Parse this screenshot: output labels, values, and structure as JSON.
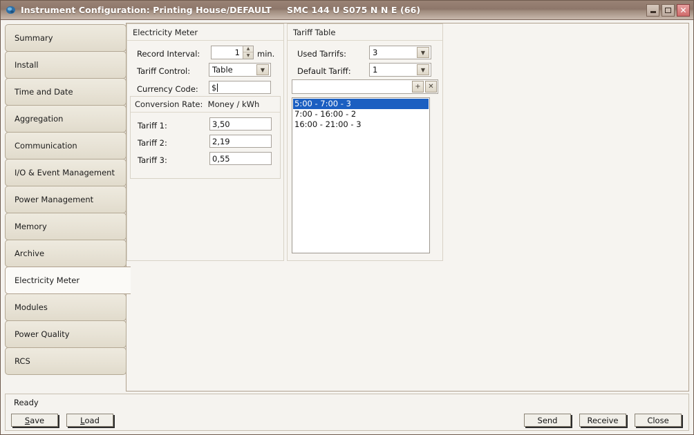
{
  "window": {
    "title": "Instrument Configuration: Printing House/DEFAULT     SMC 144 U S075 N N E (66)",
    "icon": "app-globe-icon",
    "controls": {
      "minimize": "minimize-icon",
      "maximize": "maximize-icon",
      "close": "✕"
    }
  },
  "sidebar": {
    "items": [
      {
        "label": "Summary",
        "selected": false
      },
      {
        "label": "Install",
        "selected": false
      },
      {
        "label": "Time and Date",
        "selected": false
      },
      {
        "label": "Aggregation",
        "selected": false
      },
      {
        "label": "Communication",
        "selected": false
      },
      {
        "label": "I/O & Event Management",
        "selected": false
      },
      {
        "label": "Power Management",
        "selected": false
      },
      {
        "label": "Memory",
        "selected": false
      },
      {
        "label": "Archive",
        "selected": false
      },
      {
        "label": "Electricity Meter",
        "selected": true
      },
      {
        "label": "Modules",
        "selected": false
      },
      {
        "label": "Power Quality",
        "selected": false
      },
      {
        "label": "RCS",
        "selected": false
      }
    ]
  },
  "electricity_meter": {
    "panel_title": "Electricity Meter",
    "record_interval": {
      "label": "Record Interval:",
      "value": "1",
      "unit": "min.",
      "spin_up": "▲",
      "spin_down": "▼"
    },
    "tariff_control": {
      "label": "Tariff Control:",
      "value": "Table",
      "arrow": "▼"
    },
    "currency_code": {
      "label": "Currency Code:",
      "value": "$"
    },
    "conversion_rate": {
      "title": "Conversion Rate:  Money / kWh",
      "rows": [
        {
          "label": "Tariff 1:",
          "value": "3,50"
        },
        {
          "label": "Tariff 2:",
          "value": "2,19"
        },
        {
          "label": "Tariff 3:",
          "value": "0,55"
        }
      ]
    }
  },
  "tariff_table": {
    "panel_title": "Tariff Table",
    "used_tariffs": {
      "label": "Used Tarrifs:",
      "value": "3",
      "arrow": "▼"
    },
    "default_tariff": {
      "label": "Default Tariff:",
      "value": "1",
      "arrow": "▼"
    },
    "entry_field": {
      "value": "",
      "placeholder": ""
    },
    "add_button": "+",
    "delete_button": "✕",
    "entries": [
      {
        "text": "5:00 - 7:00 - 3",
        "selected": true
      },
      {
        "text": "7:00 - 16:00 - 2",
        "selected": false
      },
      {
        "text": "16:00 - 21:00 - 3",
        "selected": false
      }
    ]
  },
  "statusbar": {
    "text": "Ready"
  },
  "buttons": {
    "save": "Save",
    "save_accel": "S",
    "load": "Load",
    "load_accel": "L",
    "send": "Send",
    "receive": "Receive",
    "close": "Close"
  },
  "colors": {
    "titlebar": "#8d766a",
    "selection": "#1b5fc1",
    "close_button": "#d06a6a",
    "panel_bg": "#f6f4f0",
    "tab_bg": "#e8e3d6"
  }
}
